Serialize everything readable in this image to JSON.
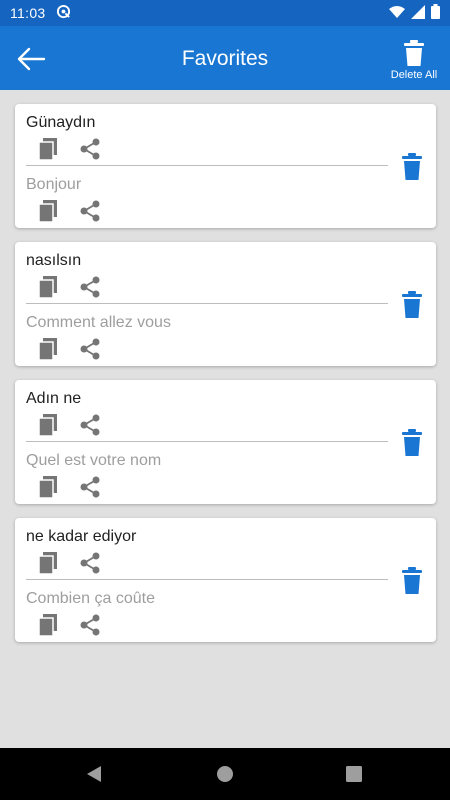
{
  "status_bar": {
    "time": "11:03",
    "icons": [
      "vpn-icon",
      "wifi-icon",
      "cellular-icon",
      "battery-icon"
    ]
  },
  "app_bar": {
    "title": "Favorites",
    "back_icon": "arrow-left-icon",
    "delete_all_label": "Delete All"
  },
  "colors": {
    "status_bar": "#1565c0",
    "app_bar": "#1976d2",
    "accent": "#1976d2",
    "background": "#e0e0e0",
    "icon_grey": "#757575"
  },
  "favorites": [
    {
      "source": "Günaydın",
      "translation": "Bonjour"
    },
    {
      "source": "nasılsın",
      "translation": "Comment allez vous"
    },
    {
      "source": "Adın ne",
      "translation": "Quel est votre nom"
    },
    {
      "source": "ne kadar ediyor",
      "translation": "Combien ça coûte"
    }
  ],
  "nav_bar": {
    "buttons": [
      "back-triangle-icon",
      "home-circle-icon",
      "recents-square-icon"
    ]
  }
}
